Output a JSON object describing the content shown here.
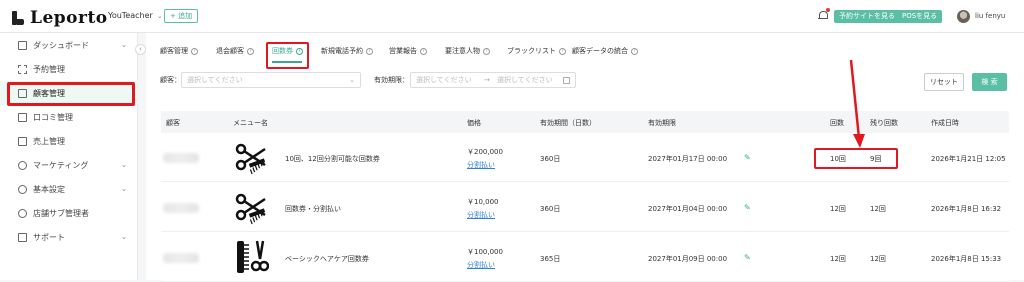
{
  "header": {
    "logo": "Leporto",
    "store": "YouTeacher",
    "add_label": "+ 追加",
    "reserve_site_button": "予約サイトを見る",
    "pos_button": "POSを見る",
    "username": "liu fenyu"
  },
  "sidebar": {
    "items": [
      {
        "label": "ダッシュボード",
        "icon": "dashboard-icon",
        "has_chevron": true
      },
      {
        "label": "予約管理",
        "icon": "list-icon",
        "has_chevron": false
      },
      {
        "label": "顧客管理",
        "icon": "customer-icon",
        "has_chevron": false,
        "active": true
      },
      {
        "label": "口コミ管理",
        "icon": "review-icon",
        "has_chevron": false
      },
      {
        "label": "売上管理",
        "icon": "sales-icon",
        "has_chevron": false
      },
      {
        "label": "マーケティング",
        "icon": "marketing-icon",
        "has_chevron": true
      },
      {
        "label": "基本設定",
        "icon": "gear-icon",
        "has_chevron": true
      },
      {
        "label": "店舗サブ管理者",
        "icon": "users-icon",
        "has_chevron": false
      },
      {
        "label": "サポート",
        "icon": "support-icon",
        "has_chevron": true
      }
    ]
  },
  "tabs": [
    {
      "label": "顧客管理"
    },
    {
      "label": "退会顧客"
    },
    {
      "label": "回数券",
      "active": true
    },
    {
      "label": "新規電話予約"
    },
    {
      "label": "営業報告"
    },
    {
      "label": "要注意人物"
    },
    {
      "label": "ブラックリスト"
    },
    {
      "label": "顧客データの統合"
    }
  ],
  "filters": {
    "customer_label": "顧客：",
    "customer_placeholder": "選択してください",
    "expiry_label": "有効期限：",
    "date_from_placeholder": "選択してください",
    "date_to_placeholder": "選択してください",
    "reset_label": "リセット",
    "search_label": "検 索"
  },
  "table": {
    "columns": [
      "顧客",
      "メニュー名",
      "価格",
      "有効期間（日数）",
      "有効期限",
      "回数",
      "残り回数",
      "作成日時"
    ],
    "rows": [
      {
        "menu": "10回、12回分割可能な回数券",
        "price": "￥200,000",
        "installment": "分割払い",
        "period": "360日",
        "expiry": "2027年01月17日 00:00",
        "count": "10回",
        "remaining": "9回",
        "created": "2026年1月21日 12:05",
        "thumb": "scissors-comb"
      },
      {
        "menu": "回数券・分割払い",
        "price": "￥10,000",
        "installment": "分割払い",
        "period": "360日",
        "expiry": "2027年01月04日 00:00",
        "count": "12回",
        "remaining": "12回",
        "created": "2026年1月8日 16:32",
        "thumb": "scissors-comb"
      },
      {
        "menu": "ベーシックヘアケア回数券",
        "price": "￥100,000",
        "installment": "分割払い",
        "period": "365日",
        "expiry": "2027年01月09日 00:00",
        "count": "12回",
        "remaining": "12回",
        "created": "2026年1月8日 15:33",
        "thumb": "comb-scissors"
      }
    ]
  },
  "colors": {
    "accent": "#5bbfa6",
    "annotation_red": "#e0191f",
    "link": "#2f80d6"
  }
}
